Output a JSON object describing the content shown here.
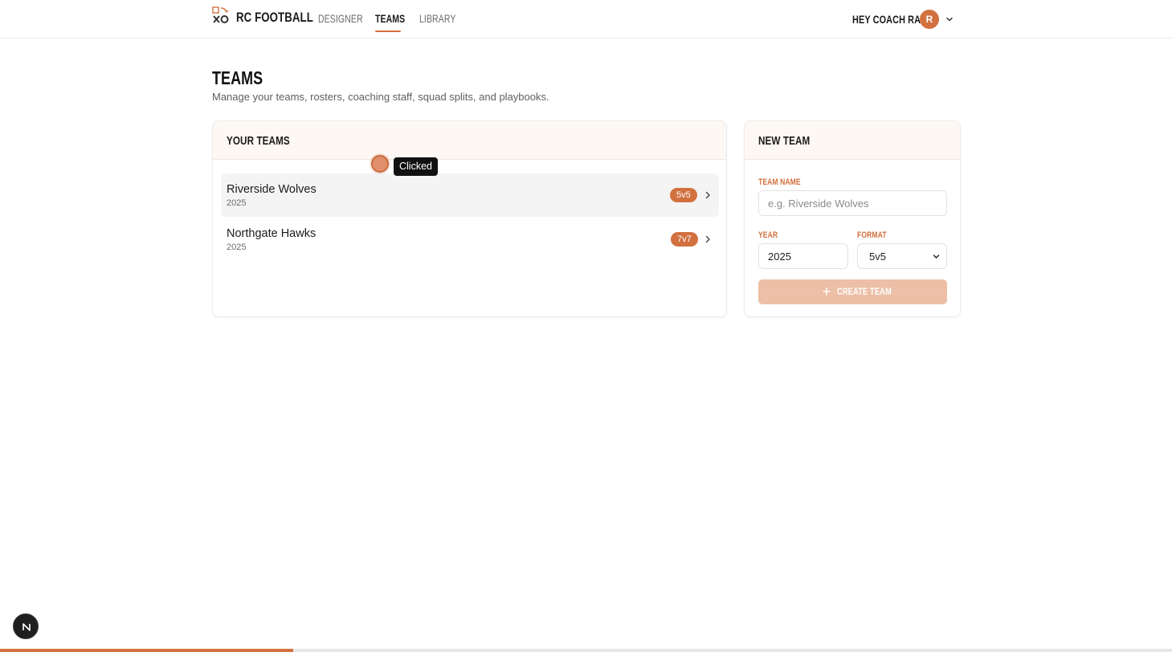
{
  "colors": {
    "accent": "#d2713f",
    "accent_light": "#ecbfa6",
    "header_tint": "#fdf8f3",
    "text_dark": "#1b1b1b",
    "text_muted": "#6b6b6b"
  },
  "header": {
    "brand": "RC FOOTBALL",
    "logo_icon": "xo-play-icon",
    "nav": [
      "DESIGNER",
      "TEAMS",
      "LIBRARY"
    ],
    "active_nav": "TEAMS",
    "greeting": "HEY COACH RAY",
    "avatar_initial": "R"
  },
  "page": {
    "title": "TEAMS",
    "subtitle": "Manage your teams, rosters, coaching staff, squad splits, and playbooks."
  },
  "teams_panel": {
    "title": "YOUR TEAMS",
    "teams": [
      {
        "name": "Riverside Wolves",
        "year": "2025",
        "format": "5v5"
      },
      {
        "name": "Northgate Hawks",
        "year": "2025",
        "format": "7v7"
      }
    ]
  },
  "new_team": {
    "title": "NEW TEAM",
    "name_label": "TEAM NAME",
    "name_placeholder": "e.g. Riverside Wolves",
    "name_value": "",
    "year_label": "YEAR",
    "year_value": "2025",
    "format_label": "FORMAT",
    "format_value": "5v5",
    "create_label": "CREATE TEAM"
  },
  "click_indicator": {
    "label": "Clicked"
  },
  "progress": {
    "fraction": 0.25
  }
}
